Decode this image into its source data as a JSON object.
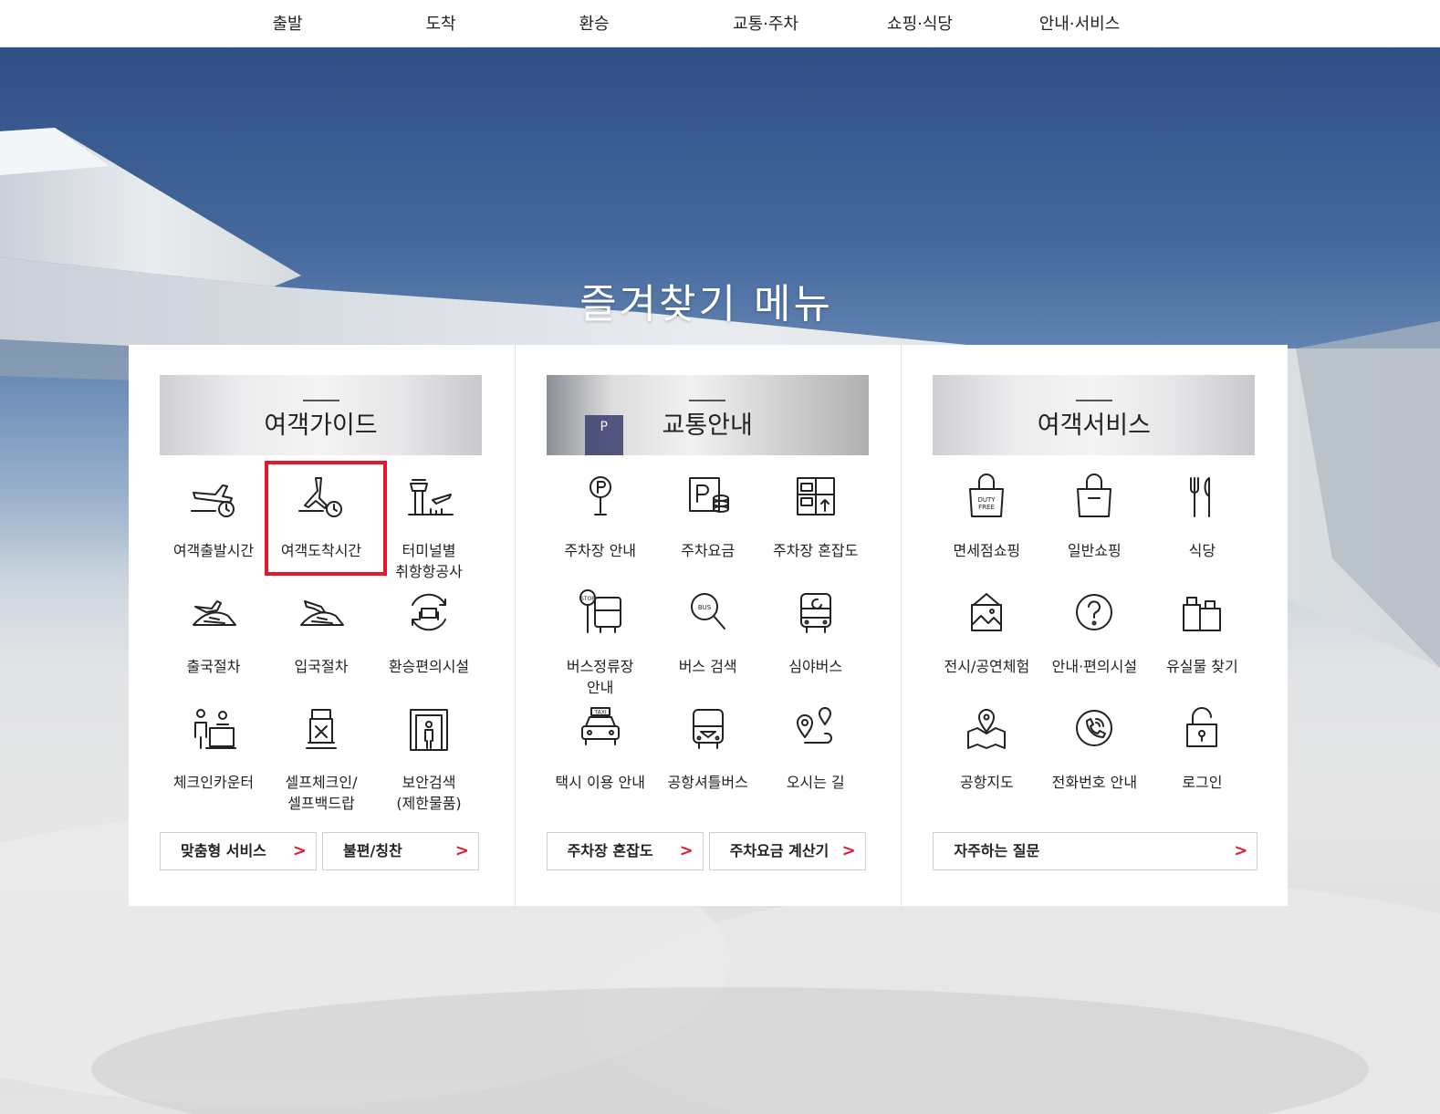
{
  "nav": {
    "items": [
      "출발",
      "도착",
      "환승",
      "교통·주차",
      "쇼핑·식당",
      "안내·서비스"
    ]
  },
  "hero": {
    "title": "즐겨찾기 메뉴"
  },
  "columns": [
    {
      "title": "여객가이드",
      "items": [
        {
          "label": "여객출발시간",
          "icon": "departure-clock-icon"
        },
        {
          "label": "여객도착시간",
          "icon": "arrival-clock-icon"
        },
        {
          "label": "터미널별\n취항항공사",
          "icon": "control-tower-icon"
        },
        {
          "label": "출국절차",
          "icon": "departure-procedure-icon"
        },
        {
          "label": "입국절차",
          "icon": "arrival-procedure-icon"
        },
        {
          "label": "환승편의시설",
          "icon": "transfer-facility-icon"
        },
        {
          "label": "체크인카운터",
          "icon": "checkin-counter-icon"
        },
        {
          "label": "셀프체크인/\n셀프백드랍",
          "icon": "self-checkin-icon"
        },
        {
          "label": "보안검색\n(제한물품)",
          "icon": "security-gate-icon"
        }
      ],
      "buttons": [
        "맞춤형 서비스",
        "불편/칭찬"
      ]
    },
    {
      "title": "교통안내",
      "items": [
        {
          "label": "주차장 안내",
          "icon": "parking-pin-icon"
        },
        {
          "label": "주차요금",
          "icon": "parking-fee-icon"
        },
        {
          "label": "주차장 혼잡도",
          "icon": "parking-congestion-icon"
        },
        {
          "label": "버스정류장\n안내",
          "icon": "bus-stop-icon"
        },
        {
          "label": "버스 검색",
          "icon": "bus-search-icon"
        },
        {
          "label": "심야버스",
          "icon": "night-bus-icon"
        },
        {
          "label": "택시 이용 안내",
          "icon": "taxi-icon"
        },
        {
          "label": "공항셔틀버스",
          "icon": "shuttle-bus-icon"
        },
        {
          "label": "오시는 길",
          "icon": "directions-icon"
        }
      ],
      "buttons": [
        "주차장 혼잡도",
        "주차요금 계산기"
      ]
    },
    {
      "title": "여객서비스",
      "items": [
        {
          "label": "면세점쇼핑",
          "icon": "duty-free-bag-icon"
        },
        {
          "label": "일반쇼핑",
          "icon": "shopping-bag-icon"
        },
        {
          "label": "식당",
          "icon": "fork-knife-icon"
        },
        {
          "label": "전시/공연체험",
          "icon": "exhibition-icon"
        },
        {
          "label": "안내·편의시설",
          "icon": "question-icon"
        },
        {
          "label": "유실물 찾기",
          "icon": "lost-luggage-icon"
        },
        {
          "label": "공항지도",
          "icon": "map-icon"
        },
        {
          "label": "전화번호 안내",
          "icon": "phone-icon"
        },
        {
          "label": "로그인",
          "icon": "lock-icon"
        }
      ],
      "buttons": [
        "자주하는 질문"
      ]
    }
  ],
  "duty_free_text": "DUTY\nFREE",
  "taxi_text": "TAXI",
  "bus_text": "BUS",
  "stop_text": "STOP",
  "parking_text": "P",
  "highlight_color": "#e5182b"
}
